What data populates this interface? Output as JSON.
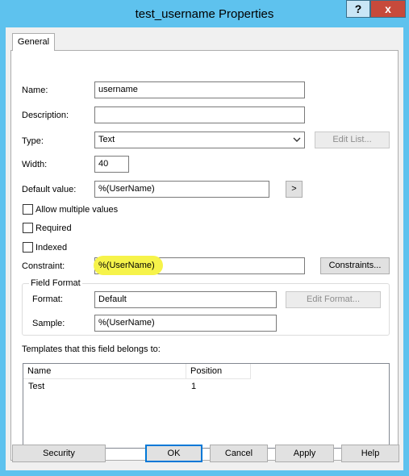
{
  "window": {
    "title": "test_username Properties",
    "help_label": "?",
    "close_label": "x"
  },
  "tabs": [
    "General"
  ],
  "form": {
    "name_label": "Name:",
    "name_value": "username",
    "description_label": "Description:",
    "description_value": "",
    "type_label": "Type:",
    "type_value": "Text",
    "edit_list_label": "Edit List...",
    "width_label": "Width:",
    "width_value": "40",
    "default_label": "Default value:",
    "default_value": "%(UserName)",
    "arrow_label": ">",
    "allow_multiple_label": "Allow multiple values",
    "required_label": "Required",
    "indexed_label": "Indexed",
    "constraint_label": "Constraint:",
    "constraint_value": "%(UserName)",
    "constraints_button_label": "Constraints...",
    "field_format_label": "Field Format",
    "format_label": "Format:",
    "format_value": "Default",
    "edit_format_label": "Edit Format...",
    "sample_label": "Sample:",
    "sample_value": "%(UserName)",
    "templates_label": "Templates that this field belongs to:"
  },
  "templates_table": {
    "columns": [
      "Name",
      "Position"
    ],
    "rows": [
      {
        "name": "Test",
        "position": "1"
      }
    ]
  },
  "footer": {
    "security": "Security",
    "ok": "OK",
    "cancel": "Cancel",
    "apply": "Apply",
    "help": "Help"
  },
  "colors": {
    "title_bar": "#5ec2ee",
    "highlight": "#f6f34a",
    "close_button": "#c74a3b"
  }
}
